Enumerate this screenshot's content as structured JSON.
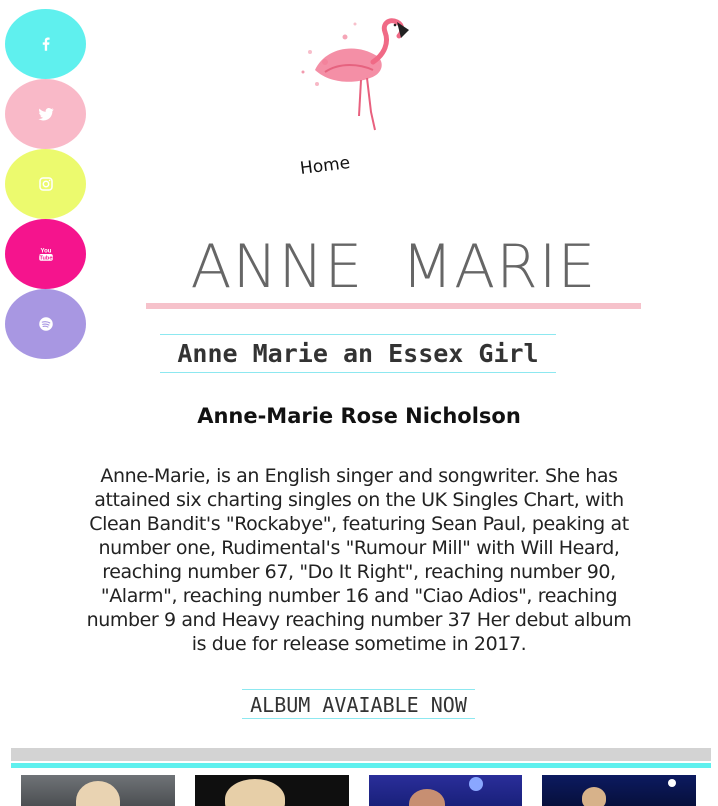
{
  "social": [
    {
      "name": "facebook",
      "icon": "facebook-icon",
      "color": "#5ff0ee"
    },
    {
      "name": "twitter",
      "icon": "twitter-icon",
      "color": "#f9b9c8"
    },
    {
      "name": "instagram",
      "icon": "instagram-icon",
      "color": "#ecfa6e"
    },
    {
      "name": "youtube",
      "icon": "youtube-icon",
      "color": "#f5148d"
    },
    {
      "name": "spotify",
      "icon": "spotify-icon",
      "color": "#a897e2"
    }
  ],
  "youtube_icon_text": {
    "line1": "You",
    "line2": "Tube"
  },
  "nav": {
    "home": "Home"
  },
  "title": "ANNE MARIE",
  "subtitle": "Anne Marie an Essex Girl",
  "fullname": "Anne-Marie Rose Nicholson",
  "bio": "Anne-Marie, is an English singer and songwriter. She has attained six charting singles on the UK Singles Chart, with Clean Bandit's \"Rockabye\", featuring Sean Paul, peaking at number one, Rudimental's \"Rumour Mill\" with Will Heard, reaching number 67, \"Do It Right\", reaching number 90, \"Alarm\", reaching number 16 and \"Ciao Adios\", reaching number 9 and Heavy reaching number 37 Her debut album is due for release sometime in 2017.",
  "album_link": "ALBUM AVAIABLE NOW",
  "colors": {
    "accent_pink": "#f6c2cb",
    "accent_cyan": "#5ff0ee",
    "title_grey": "#666666"
  }
}
